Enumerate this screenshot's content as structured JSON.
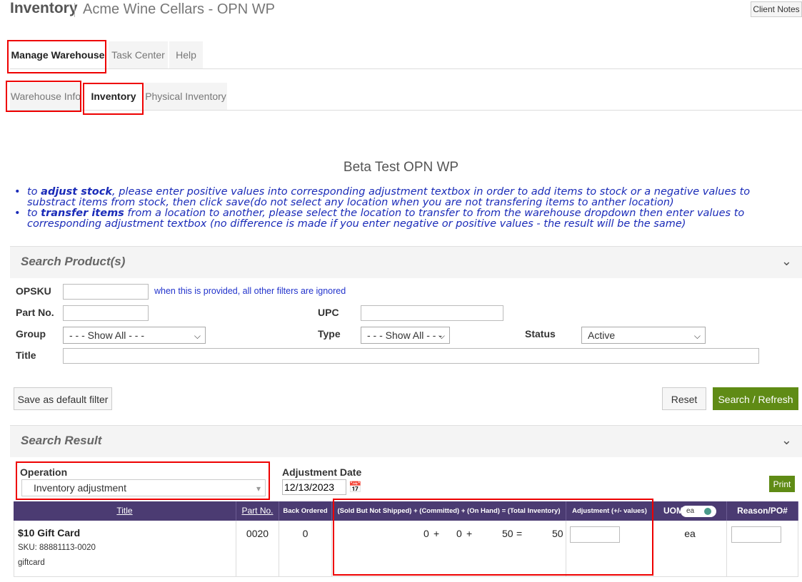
{
  "header": {
    "app_title": "Inventory",
    "subtitle": "Acme Wine Cellars - OPN WP",
    "client_notes": "Client Notes"
  },
  "main_tabs": [
    {
      "label": "Manage Warehouse",
      "active": true
    },
    {
      "label": "Task Center",
      "active": false
    },
    {
      "label": "Help",
      "active": false
    }
  ],
  "sub_tabs": [
    {
      "label": "Warehouse Info",
      "active": false
    },
    {
      "label": "Inventory",
      "active": true
    },
    {
      "label": "Physical Inventory",
      "active": false
    }
  ],
  "warehouse_name": "Beta Test OPN WP",
  "instructions": {
    "adjust": {
      "prefix": "to ",
      "bold": "adjust stock",
      "text": ", please enter positive values into corresponding adjustment textbox in order to add items to stock or a negative values to substract items from stock, then click save(do not select any location when you are not transfering items to anther location)"
    },
    "transfer": {
      "prefix": "to ",
      "bold": "transfer items",
      "text": " from a location to another, please select the location to transfer to from the warehouse dropdown then enter values to corresponding adjustment textbox (no difference is made if you enter negative or positive values - the result will be the same)"
    }
  },
  "search": {
    "section_title": "Search Product(s)",
    "opsku_label": "OPSKU",
    "opsku_value": "",
    "opsku_hint": "when this is provided, all other filters are ignored",
    "part_label": "Part No.",
    "part_value": "",
    "upc_label": "UPC",
    "upc_value": "",
    "group_label": "Group",
    "group_value": "- - - Show All - - -",
    "type_label": "Type",
    "type_value": "- - - Show All - - -",
    "status_label": "Status",
    "status_value": "Active",
    "title_label": "Title",
    "title_value": "",
    "save_default": "Save as default filter",
    "reset": "Reset",
    "search_refresh": "Search / Refresh"
  },
  "result": {
    "section_title": "Search Result",
    "operation_label": "Operation",
    "operation_value": "Inventory adjustment",
    "adj_date_label": "Adjustment Date",
    "adj_date_value": "12/13/2023",
    "print": "Print",
    "columns": {
      "title": "Title",
      "part": "Part No.",
      "back_ordered": "Back Ordered",
      "inventory_formula": "(Sold But Not Shipped) + (Committed) + (On Hand) = (Total Inventory)",
      "adjustment": "Adjustment (+/- values)",
      "uom": "UOM",
      "uom_toggle": "ea",
      "reason": "Reason/PO#"
    },
    "rows": [
      {
        "title": "$10 Gift Card",
        "sku": "SKU: 88881113-0020",
        "category": "giftcard",
        "part": "0020",
        "back_ordered": "0",
        "sold_not_shipped": "0",
        "plus1": "+",
        "committed": "0",
        "plus2": "+",
        "on_hand": "50",
        "equals": "=",
        "total": "50",
        "adjustment": "",
        "uom": "ea",
        "reason": ""
      }
    ]
  },
  "colors": {
    "accent_purple": "#4b3b72",
    "green_button": "#5f8b15",
    "highlight_red": "#e00000",
    "note_blue": "#1a2bb8"
  }
}
